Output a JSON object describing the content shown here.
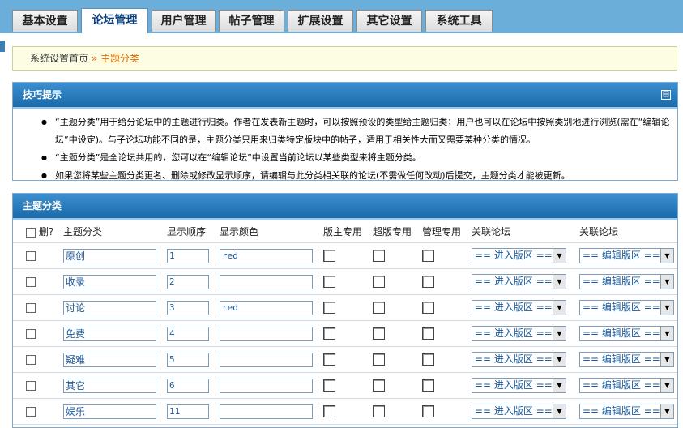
{
  "tabs": [
    {
      "label": "基本设置"
    },
    {
      "label": "论坛管理"
    },
    {
      "label": "用户管理"
    },
    {
      "label": "帖子管理"
    },
    {
      "label": "扩展设置"
    },
    {
      "label": "其它设置"
    },
    {
      "label": "系统工具"
    }
  ],
  "breadcrumb": {
    "home": "系统设置首页",
    "sep": "»",
    "current": "主题分类"
  },
  "tips": {
    "title": "技巧提示",
    "collapse_icon": "⊟",
    "items": [
      "“主题分类”用于给分论坛中的主题进行归类。作者在发表新主题时，可以按照预设的类型给主题归类；用户也可以在论坛中按照类别地进行浏览(需在“编辑论坛”中设定)。与子论坛功能不同的是，主题分类只用来归类特定版块中的帖子，适用于相关性大而又需要某种分类的情况。",
      "“主题分类”是全论坛共用的，您可以在“编辑论坛”中设置当前论坛以某些类型来将主题分类。",
      "如果您将某些主题分类更名、删除或修改显示顺序，请编辑与此分类相关联的论坛(不需做任何改动)后提交，主题分类才能被更新。"
    ]
  },
  "table": {
    "title": "主题分类",
    "headers": {
      "delete": "删?",
      "name": "主题分类",
      "order": "显示顺序",
      "color": "显示颜色",
      "moderator": "版主专用",
      "super": "超版专用",
      "admin": "管理专用",
      "forum1": "关联论坛",
      "forum2": "关联论坛"
    },
    "select1": "== 进入版区 ==",
    "select2": "== 编辑版区 ==",
    "rows": [
      {
        "name": "原创",
        "order": "1",
        "color": "red"
      },
      {
        "name": "收录",
        "order": "2",
        "color": ""
      },
      {
        "name": "讨论",
        "order": "3",
        "color": "red"
      },
      {
        "name": "免费",
        "order": "4",
        "color": ""
      },
      {
        "name": "疑难",
        "order": "5",
        "color": ""
      },
      {
        "name": "其它",
        "order": "6",
        "color": ""
      },
      {
        "name": "娱乐",
        "order": "11",
        "color": ""
      }
    ]
  }
}
